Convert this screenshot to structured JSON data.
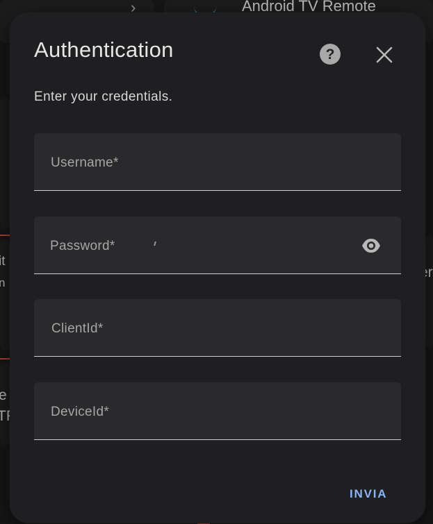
{
  "background": {
    "top_card_title": "Android TV Remote",
    "fragment_it": "it",
    "fragment_n": "n",
    "fragment_e": "e",
    "fragment_tf": "TF",
    "fragment_right": "er"
  },
  "dialog": {
    "title": "Authentication",
    "subtitle": "Enter your credentials.",
    "help_icon": "help-circle-icon",
    "close_icon": "close-icon",
    "fields": [
      {
        "label": "Username*",
        "value": ""
      },
      {
        "label": "Password*",
        "value": "",
        "toggle_icon": "eye-icon"
      },
      {
        "label": "ClientId*",
        "value": ""
      },
      {
        "label": "DeviceId*",
        "value": ""
      }
    ],
    "submit_label": "INVIA"
  },
  "colors": {
    "dialog_bg": "#1f1f22",
    "field_bg": "#2a2a2d",
    "accent": "#8ab4f8"
  }
}
